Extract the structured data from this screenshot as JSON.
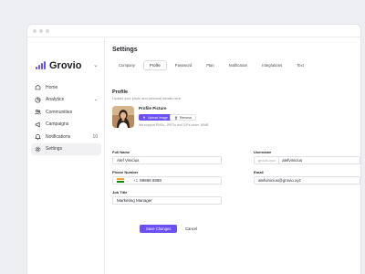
{
  "app": {
    "name": "Grovio"
  },
  "sidebar": {
    "items": [
      {
        "label": "Home",
        "trail": ""
      },
      {
        "label": "Analytics",
        "trail": "⌄"
      },
      {
        "label": "Communities",
        "trail": ""
      },
      {
        "label": "Campaigns",
        "trail": ""
      },
      {
        "label": "Notifications",
        "trail": "10"
      },
      {
        "label": "Settings",
        "trail": ""
      }
    ]
  },
  "page": {
    "title": "Settings",
    "tabs": [
      "Company",
      "Profile",
      "Password",
      "Plan",
      "Notification",
      "Integrations",
      "Text"
    ],
    "active_tab": "Profile"
  },
  "profile": {
    "title": "Profile",
    "subtitle": "Update your photo and personal details here.",
    "picture_label": "Profile Picture",
    "upload_label": "Upload Image",
    "remove_label": "Remove",
    "picture_hint": "We support PNGs, JPEGs and GIFs under 10MB"
  },
  "form": {
    "full_name": {
      "label": "Full Name",
      "value": "Alef Vinicius"
    },
    "username": {
      "label": "Username",
      "prefix": "grovio.xyz/",
      "value": "alefvinicius"
    },
    "phone": {
      "label": "Phone Number",
      "dial_code": "+1",
      "value": "88888 8888"
    },
    "email": {
      "label": "Email",
      "value": "alefvinicius@grovio.xyz"
    },
    "job_title": {
      "label": "Job Title",
      "value": "Marketing Manager"
    }
  },
  "actions": {
    "save_label": "Save Changes",
    "cancel_label": "Cancel"
  },
  "colors": {
    "accent": "#6c4ff5",
    "background": "#eeeff2"
  }
}
